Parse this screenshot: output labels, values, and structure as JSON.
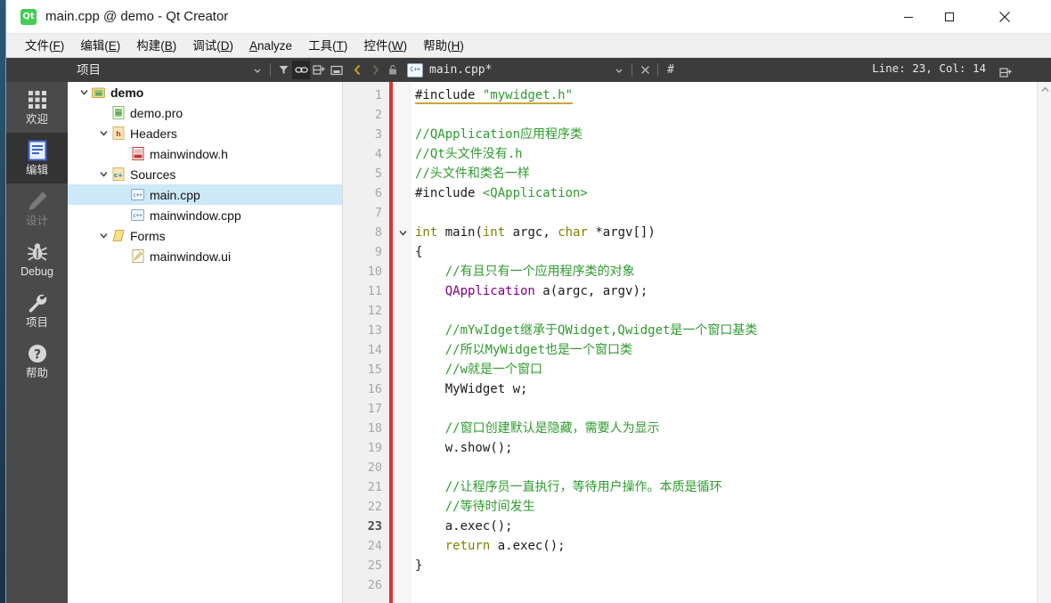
{
  "window": {
    "title": "main.cpp @ demo - Qt Creator",
    "app_icon": "qt-logo-icon",
    "minimize_label": "Minimize",
    "maximize_label": "Maximize",
    "close_label": "Close"
  },
  "menubar": {
    "items": [
      {
        "text": "文件(F)",
        "pre": "文件(",
        "mnemonic": "F",
        "post": ")"
      },
      {
        "text": "编辑(E)",
        "pre": "编辑(",
        "mnemonic": "E",
        "post": ")"
      },
      {
        "text": "构建(B)",
        "pre": "构建(",
        "mnemonic": "B",
        "post": ")"
      },
      {
        "text": "调试(D)",
        "pre": "调试(",
        "mnemonic": "D",
        "post": ")"
      },
      {
        "text": "Analyze",
        "pre": "",
        "mnemonic": "A",
        "post": "nalyze"
      },
      {
        "text": "工具(T)",
        "pre": "工具(",
        "mnemonic": "T",
        "post": ")"
      },
      {
        "text": "控件(W)",
        "pre": "控件(",
        "mnemonic": "W",
        "post": ")"
      },
      {
        "text": "帮助(H)",
        "pre": "帮助(",
        "mnemonic": "H",
        "post": ")"
      }
    ]
  },
  "project_toolbar": {
    "selector_label": "项目",
    "icons": [
      "chevron-down-icon",
      "filter-icon",
      "link-icon",
      "split-icon",
      "float-icon"
    ]
  },
  "editor_toolbar": {
    "back_label": "<",
    "forward_label": ">",
    "lock_icon": "lock-icon",
    "file_icon": "cpp-file-icon",
    "file_name": "main.cpp*",
    "dropdown_icon": "chevron-down-icon",
    "close_icon": "close-icon",
    "hash_icon": "#",
    "line_col": "Line: 23, Col: 14",
    "split_icon": "split-icon"
  },
  "modebar": {
    "items": [
      {
        "label": "欢迎",
        "icon": "grid-icon",
        "state": "normal"
      },
      {
        "label": "编辑",
        "icon": "document-lines-icon",
        "state": "selected"
      },
      {
        "label": "设计",
        "icon": "pencil-icon",
        "state": "disabled"
      },
      {
        "label": "Debug",
        "icon": "bug-icon",
        "state": "normal"
      },
      {
        "label": "项目",
        "icon": "wrench-icon",
        "state": "normal"
      },
      {
        "label": "帮助",
        "icon": "question-circle-icon",
        "state": "normal"
      }
    ]
  },
  "project_tree": {
    "rows": [
      {
        "label": "demo",
        "indent": 0,
        "chevron": "v",
        "icon": "project-icon",
        "bold": true,
        "selected": false
      },
      {
        "label": "demo.pro",
        "indent": 1,
        "chevron": "",
        "icon": "pro-file-icon",
        "bold": false,
        "selected": false
      },
      {
        "label": "Headers",
        "indent": 1,
        "chevron": "v",
        "icon": "headers-folder-icon",
        "bold": false,
        "selected": false
      },
      {
        "label": "mainwindow.h",
        "indent": 2,
        "chevron": "",
        "icon": "h-file-icon",
        "bold": false,
        "selected": false
      },
      {
        "label": "Sources",
        "indent": 1,
        "chevron": "v",
        "icon": "sources-folder-icon",
        "bold": false,
        "selected": false
      },
      {
        "label": "main.cpp",
        "indent": 2,
        "chevron": "",
        "icon": "cpp-file-icon",
        "bold": false,
        "selected": true
      },
      {
        "label": "mainwindow.cpp",
        "indent": 2,
        "chevron": "",
        "icon": "cpp-file-icon",
        "bold": false,
        "selected": false
      },
      {
        "label": "Forms",
        "indent": 1,
        "chevron": "v",
        "icon": "forms-folder-icon",
        "bold": false,
        "selected": false
      },
      {
        "label": "mainwindow.ui",
        "indent": 2,
        "chevron": "",
        "icon": "ui-file-icon",
        "bold": false,
        "selected": false
      }
    ]
  },
  "editor": {
    "current_line": 23,
    "first_line": 1,
    "last_visible_line": 26,
    "lines": [
      {
        "n": 1,
        "fold": "",
        "tokens": [
          {
            "t": "#include ",
            "c": "pp err"
          },
          {
            "t": "\"mywidget.h\"",
            "c": "str err"
          }
        ]
      },
      {
        "n": 2,
        "fold": "",
        "tokens": []
      },
      {
        "n": 3,
        "fold": "",
        "tokens": [
          {
            "t": "//QApplication应用程序类",
            "c": "cm"
          }
        ]
      },
      {
        "n": 4,
        "fold": "",
        "tokens": [
          {
            "t": "//Qt头文件没有.h",
            "c": "cm"
          }
        ]
      },
      {
        "n": 5,
        "fold": "",
        "tokens": [
          {
            "t": "//头文件和类名一样",
            "c": "cm"
          }
        ]
      },
      {
        "n": 6,
        "fold": "",
        "tokens": [
          {
            "t": "#include ",
            "c": "pp"
          },
          {
            "t": "<QApplication>",
            "c": "inc"
          }
        ]
      },
      {
        "n": 7,
        "fold": "",
        "tokens": []
      },
      {
        "n": 8,
        "fold": "v",
        "tokens": [
          {
            "t": "int",
            "c": "kw"
          },
          {
            "t": " main(",
            "c": "pp"
          },
          {
            "t": "int",
            "c": "kw"
          },
          {
            "t": " argc, ",
            "c": "pp"
          },
          {
            "t": "char",
            "c": "kw"
          },
          {
            "t": " *argv[])",
            "c": "pp"
          }
        ]
      },
      {
        "n": 9,
        "fold": "",
        "tokens": [
          {
            "t": "{",
            "c": "pp"
          }
        ]
      },
      {
        "n": 10,
        "fold": "",
        "tokens": [
          {
            "t": "    //有且只有一个应用程序类的对象",
            "c": "cm"
          }
        ]
      },
      {
        "n": 11,
        "fold": "",
        "tokens": [
          {
            "t": "    ",
            "c": "pp"
          },
          {
            "t": "QApplication",
            "c": "ty"
          },
          {
            "t": " a(argc, argv);",
            "c": "pp"
          }
        ]
      },
      {
        "n": 12,
        "fold": "",
        "tokens": []
      },
      {
        "n": 13,
        "fold": "",
        "tokens": [
          {
            "t": "    //mYwIdget继承于QWidget,Qwidget是一个窗口基类",
            "c": "cm"
          }
        ]
      },
      {
        "n": 14,
        "fold": "",
        "tokens": [
          {
            "t": "    //所以MyWidget也是一个窗口类",
            "c": "cm"
          }
        ]
      },
      {
        "n": 15,
        "fold": "",
        "tokens": [
          {
            "t": "    //w就是一个窗口",
            "c": "cm"
          }
        ]
      },
      {
        "n": 16,
        "fold": "",
        "tokens": [
          {
            "t": "    MyWidget w;",
            "c": "pp"
          }
        ]
      },
      {
        "n": 17,
        "fold": "",
        "tokens": []
      },
      {
        "n": 18,
        "fold": "",
        "tokens": [
          {
            "t": "    //窗口创建默认是隐藏，需要人为显示",
            "c": "cm"
          }
        ]
      },
      {
        "n": 19,
        "fold": "",
        "tokens": [
          {
            "t": "    w.show();",
            "c": "pp"
          }
        ]
      },
      {
        "n": 20,
        "fold": "",
        "tokens": []
      },
      {
        "n": 21,
        "fold": "",
        "tokens": [
          {
            "t": "    //让程序员一直执行，等待用户操作。本质是循环",
            "c": "cm"
          }
        ]
      },
      {
        "n": 22,
        "fold": "",
        "tokens": [
          {
            "t": "    //等待时间发生",
            "c": "cm"
          }
        ]
      },
      {
        "n": 23,
        "fold": "",
        "tokens": [
          {
            "t": "    a.exec();",
            "c": "pp"
          }
        ]
      },
      {
        "n": 24,
        "fold": "",
        "tokens": [
          {
            "t": "    ",
            "c": "pp"
          },
          {
            "t": "return",
            "c": "kw"
          },
          {
            "t": " a.exec();",
            "c": "pp"
          }
        ]
      },
      {
        "n": 25,
        "fold": "",
        "tokens": [
          {
            "t": "}",
            "c": "pp"
          }
        ]
      },
      {
        "n": 26,
        "fold": "",
        "tokens": []
      }
    ]
  },
  "colors": {
    "modebar_bg": "#4a4a4a",
    "toolstrip_bg": "#3c3c3c",
    "selection_blue": "#cde8f7",
    "modified_red": "#e42f2f",
    "comment_green": "#2e9b2e",
    "keyword_olive": "#808000",
    "type_purple": "#800080",
    "qt_green": "#41cd52"
  }
}
